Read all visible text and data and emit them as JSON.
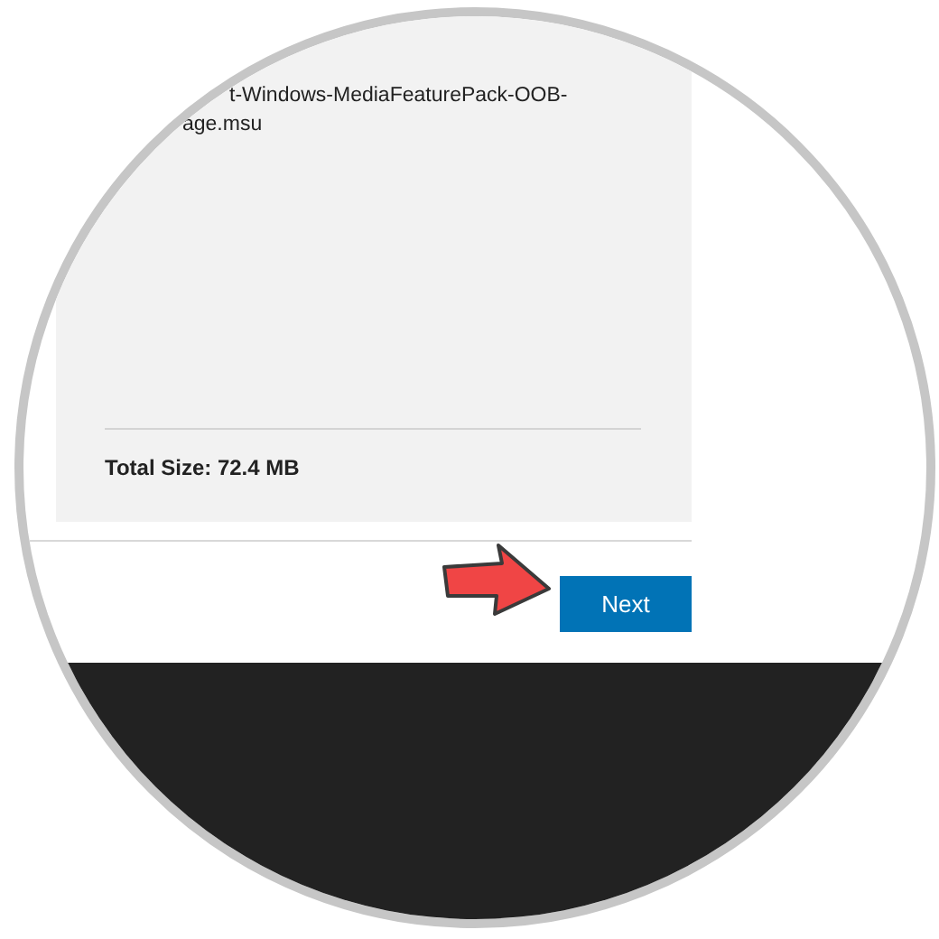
{
  "file_name_lines": [
    "t-Windows-MediaFeaturePack-OOB-",
    "age.msu"
  ],
  "total_size": "Total Size: 72.4 MB",
  "next_button": "Next"
}
